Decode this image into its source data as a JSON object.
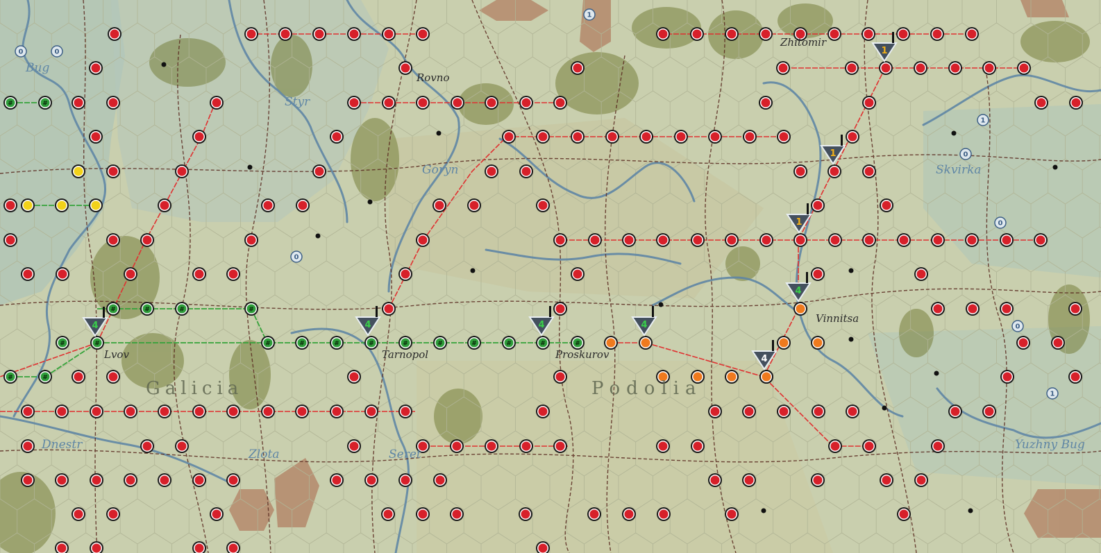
{
  "map": {
    "colors": {
      "background": "#c9cfae",
      "axis_node": "#d7202a",
      "soviet_node": "#2e9e3a",
      "orange_node": "#ef7a1e",
      "yellow_node": "#f2d21a",
      "rail_red": "#e03030",
      "rail_green": "#35a33a",
      "road": "#5a2a20",
      "river": "#5f86a5",
      "forest": "#6f7a3a",
      "marsh": "#8fb0b6",
      "hill": "#a99a7a",
      "brown_hex": "#b5896c"
    },
    "regions": [
      {
        "name": "region-galicia",
        "text": "Galicia"
      },
      {
        "name": "region-podolia",
        "text": "Podolia"
      }
    ],
    "rivers": [
      {
        "name": "river-label-bug",
        "text": "Bug"
      },
      {
        "name": "river-label-styr",
        "text": "Styr"
      },
      {
        "name": "river-label-goryn",
        "text": "Goryn"
      },
      {
        "name": "river-label-skvirka",
        "text": "Skvirka"
      },
      {
        "name": "river-label-dnestr",
        "text": "Dnestr"
      },
      {
        "name": "river-label-zlota",
        "text": "Zlota"
      },
      {
        "name": "river-label-seret",
        "text": "Seret"
      },
      {
        "name": "river-label-yuzhny-bug",
        "text": "Yuzhny Bug"
      }
    ],
    "cities": [
      {
        "name": "city-label-zhitomir",
        "text": "Zhitomir"
      },
      {
        "name": "city-label-rovno",
        "text": "Rovno"
      },
      {
        "name": "city-label-vinnitsa",
        "text": "Vinnitsa"
      },
      {
        "name": "city-label-lvov",
        "text": "Lvov"
      },
      {
        "name": "city-label-tarnopol",
        "text": "Tarnopol"
      },
      {
        "name": "city-label-proskurov",
        "text": "Proskurov"
      }
    ],
    "units": [
      {
        "name": "unit-counter-1-zhitomir",
        "value": "1"
      },
      {
        "name": "unit-counter-1-north",
        "value": "1"
      },
      {
        "name": "unit-counter-1-center",
        "value": "1"
      },
      {
        "name": "unit-counter-4-vinnitsa",
        "value": "4"
      },
      {
        "name": "unit-counter-4-east",
        "value": "4"
      },
      {
        "name": "unit-counter-4-lvov",
        "value": "4"
      },
      {
        "name": "unit-counter-4-tarnopol",
        "value": "4"
      },
      {
        "name": "unit-counter-4-proskurov",
        "value": "4"
      },
      {
        "name": "unit-counter-4-orange",
        "value": "4"
      }
    ],
    "badges": [
      {
        "value": "0"
      },
      {
        "value": "0"
      },
      {
        "value": "1"
      },
      {
        "value": "0"
      },
      {
        "value": "0"
      },
      {
        "value": "0"
      },
      {
        "value": "0"
      },
      {
        "value": "1"
      },
      {
        "value": "1"
      }
    ]
  }
}
